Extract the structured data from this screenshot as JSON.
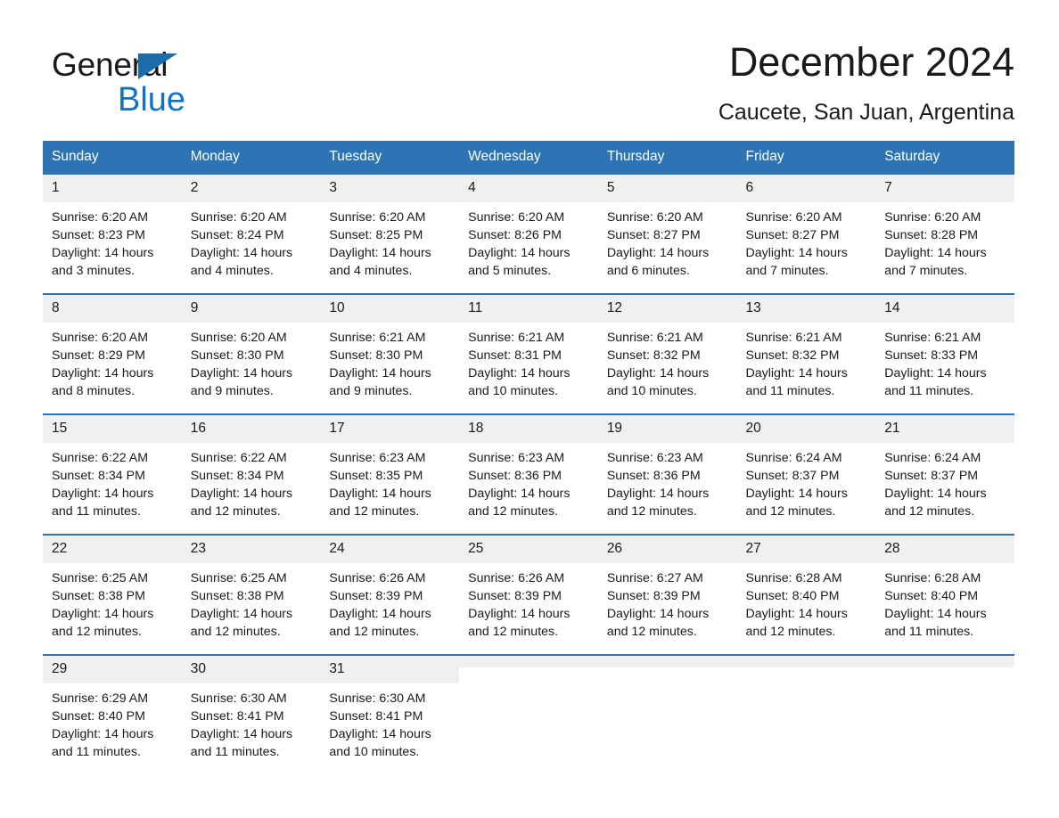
{
  "brand": {
    "name_part1": "General",
    "name_part2": "Blue",
    "triangle_color": "#1b6ca8",
    "blue_color": "#1273c4"
  },
  "header": {
    "month_title": "December 2024",
    "location": "Caucete, San Juan, Argentina"
  },
  "theme": {
    "header_blue": "#2c74b3",
    "daynum_gray": "#f0f0f0",
    "text_color": "#1a1a1a"
  },
  "weekday_headers": [
    "Sunday",
    "Monday",
    "Tuesday",
    "Wednesday",
    "Thursday",
    "Friday",
    "Saturday"
  ],
  "weeks": [
    [
      {
        "day": "1",
        "sunrise": "Sunrise: 6:20 AM",
        "sunset": "Sunset: 8:23 PM",
        "daylight_line1": "Daylight: 14 hours",
        "daylight_line2": "and 3 minutes."
      },
      {
        "day": "2",
        "sunrise": "Sunrise: 6:20 AM",
        "sunset": "Sunset: 8:24 PM",
        "daylight_line1": "Daylight: 14 hours",
        "daylight_line2": "and 4 minutes."
      },
      {
        "day": "3",
        "sunrise": "Sunrise: 6:20 AM",
        "sunset": "Sunset: 8:25 PM",
        "daylight_line1": "Daylight: 14 hours",
        "daylight_line2": "and 4 minutes."
      },
      {
        "day": "4",
        "sunrise": "Sunrise: 6:20 AM",
        "sunset": "Sunset: 8:26 PM",
        "daylight_line1": "Daylight: 14 hours",
        "daylight_line2": "and 5 minutes."
      },
      {
        "day": "5",
        "sunrise": "Sunrise: 6:20 AM",
        "sunset": "Sunset: 8:27 PM",
        "daylight_line1": "Daylight: 14 hours",
        "daylight_line2": "and 6 minutes."
      },
      {
        "day": "6",
        "sunrise": "Sunrise: 6:20 AM",
        "sunset": "Sunset: 8:27 PM",
        "daylight_line1": "Daylight: 14 hours",
        "daylight_line2": "and 7 minutes."
      },
      {
        "day": "7",
        "sunrise": "Sunrise: 6:20 AM",
        "sunset": "Sunset: 8:28 PM",
        "daylight_line1": "Daylight: 14 hours",
        "daylight_line2": "and 7 minutes."
      }
    ],
    [
      {
        "day": "8",
        "sunrise": "Sunrise: 6:20 AM",
        "sunset": "Sunset: 8:29 PM",
        "daylight_line1": "Daylight: 14 hours",
        "daylight_line2": "and 8 minutes."
      },
      {
        "day": "9",
        "sunrise": "Sunrise: 6:20 AM",
        "sunset": "Sunset: 8:30 PM",
        "daylight_line1": "Daylight: 14 hours",
        "daylight_line2": "and 9 minutes."
      },
      {
        "day": "10",
        "sunrise": "Sunrise: 6:21 AM",
        "sunset": "Sunset: 8:30 PM",
        "daylight_line1": "Daylight: 14 hours",
        "daylight_line2": "and 9 minutes."
      },
      {
        "day": "11",
        "sunrise": "Sunrise: 6:21 AM",
        "sunset": "Sunset: 8:31 PM",
        "daylight_line1": "Daylight: 14 hours",
        "daylight_line2": "and 10 minutes."
      },
      {
        "day": "12",
        "sunrise": "Sunrise: 6:21 AM",
        "sunset": "Sunset: 8:32 PM",
        "daylight_line1": "Daylight: 14 hours",
        "daylight_line2": "and 10 minutes."
      },
      {
        "day": "13",
        "sunrise": "Sunrise: 6:21 AM",
        "sunset": "Sunset: 8:32 PM",
        "daylight_line1": "Daylight: 14 hours",
        "daylight_line2": "and 11 minutes."
      },
      {
        "day": "14",
        "sunrise": "Sunrise: 6:21 AM",
        "sunset": "Sunset: 8:33 PM",
        "daylight_line1": "Daylight: 14 hours",
        "daylight_line2": "and 11 minutes."
      }
    ],
    [
      {
        "day": "15",
        "sunrise": "Sunrise: 6:22 AM",
        "sunset": "Sunset: 8:34 PM",
        "daylight_line1": "Daylight: 14 hours",
        "daylight_line2": "and 11 minutes."
      },
      {
        "day": "16",
        "sunrise": "Sunrise: 6:22 AM",
        "sunset": "Sunset: 8:34 PM",
        "daylight_line1": "Daylight: 14 hours",
        "daylight_line2": "and 12 minutes."
      },
      {
        "day": "17",
        "sunrise": "Sunrise: 6:23 AM",
        "sunset": "Sunset: 8:35 PM",
        "daylight_line1": "Daylight: 14 hours",
        "daylight_line2": "and 12 minutes."
      },
      {
        "day": "18",
        "sunrise": "Sunrise: 6:23 AM",
        "sunset": "Sunset: 8:36 PM",
        "daylight_line1": "Daylight: 14 hours",
        "daylight_line2": "and 12 minutes."
      },
      {
        "day": "19",
        "sunrise": "Sunrise: 6:23 AM",
        "sunset": "Sunset: 8:36 PM",
        "daylight_line1": "Daylight: 14 hours",
        "daylight_line2": "and 12 minutes."
      },
      {
        "day": "20",
        "sunrise": "Sunrise: 6:24 AM",
        "sunset": "Sunset: 8:37 PM",
        "daylight_line1": "Daylight: 14 hours",
        "daylight_line2": "and 12 minutes."
      },
      {
        "day": "21",
        "sunrise": "Sunrise: 6:24 AM",
        "sunset": "Sunset: 8:37 PM",
        "daylight_line1": "Daylight: 14 hours",
        "daylight_line2": "and 12 minutes."
      }
    ],
    [
      {
        "day": "22",
        "sunrise": "Sunrise: 6:25 AM",
        "sunset": "Sunset: 8:38 PM",
        "daylight_line1": "Daylight: 14 hours",
        "daylight_line2": "and 12 minutes."
      },
      {
        "day": "23",
        "sunrise": "Sunrise: 6:25 AM",
        "sunset": "Sunset: 8:38 PM",
        "daylight_line1": "Daylight: 14 hours",
        "daylight_line2": "and 12 minutes."
      },
      {
        "day": "24",
        "sunrise": "Sunrise: 6:26 AM",
        "sunset": "Sunset: 8:39 PM",
        "daylight_line1": "Daylight: 14 hours",
        "daylight_line2": "and 12 minutes."
      },
      {
        "day": "25",
        "sunrise": "Sunrise: 6:26 AM",
        "sunset": "Sunset: 8:39 PM",
        "daylight_line1": "Daylight: 14 hours",
        "daylight_line2": "and 12 minutes."
      },
      {
        "day": "26",
        "sunrise": "Sunrise: 6:27 AM",
        "sunset": "Sunset: 8:39 PM",
        "daylight_line1": "Daylight: 14 hours",
        "daylight_line2": "and 12 minutes."
      },
      {
        "day": "27",
        "sunrise": "Sunrise: 6:28 AM",
        "sunset": "Sunset: 8:40 PM",
        "daylight_line1": "Daylight: 14 hours",
        "daylight_line2": "and 12 minutes."
      },
      {
        "day": "28",
        "sunrise": "Sunrise: 6:28 AM",
        "sunset": "Sunset: 8:40 PM",
        "daylight_line1": "Daylight: 14 hours",
        "daylight_line2": "and 11 minutes."
      }
    ],
    [
      {
        "day": "29",
        "sunrise": "Sunrise: 6:29 AM",
        "sunset": "Sunset: 8:40 PM",
        "daylight_line1": "Daylight: 14 hours",
        "daylight_line2": "and 11 minutes."
      },
      {
        "day": "30",
        "sunrise": "Sunrise: 6:30 AM",
        "sunset": "Sunset: 8:41 PM",
        "daylight_line1": "Daylight: 14 hours",
        "daylight_line2": "and 11 minutes."
      },
      {
        "day": "31",
        "sunrise": "Sunrise: 6:30 AM",
        "sunset": "Sunset: 8:41 PM",
        "daylight_line1": "Daylight: 14 hours",
        "daylight_line2": "and 10 minutes."
      },
      {
        "day": "",
        "sunrise": "",
        "sunset": "",
        "daylight_line1": "",
        "daylight_line2": ""
      },
      {
        "day": "",
        "sunrise": "",
        "sunset": "",
        "daylight_line1": "",
        "daylight_line2": ""
      },
      {
        "day": "",
        "sunrise": "",
        "sunset": "",
        "daylight_line1": "",
        "daylight_line2": ""
      },
      {
        "day": "",
        "sunrise": "",
        "sunset": "",
        "daylight_line1": "",
        "daylight_line2": ""
      }
    ]
  ]
}
